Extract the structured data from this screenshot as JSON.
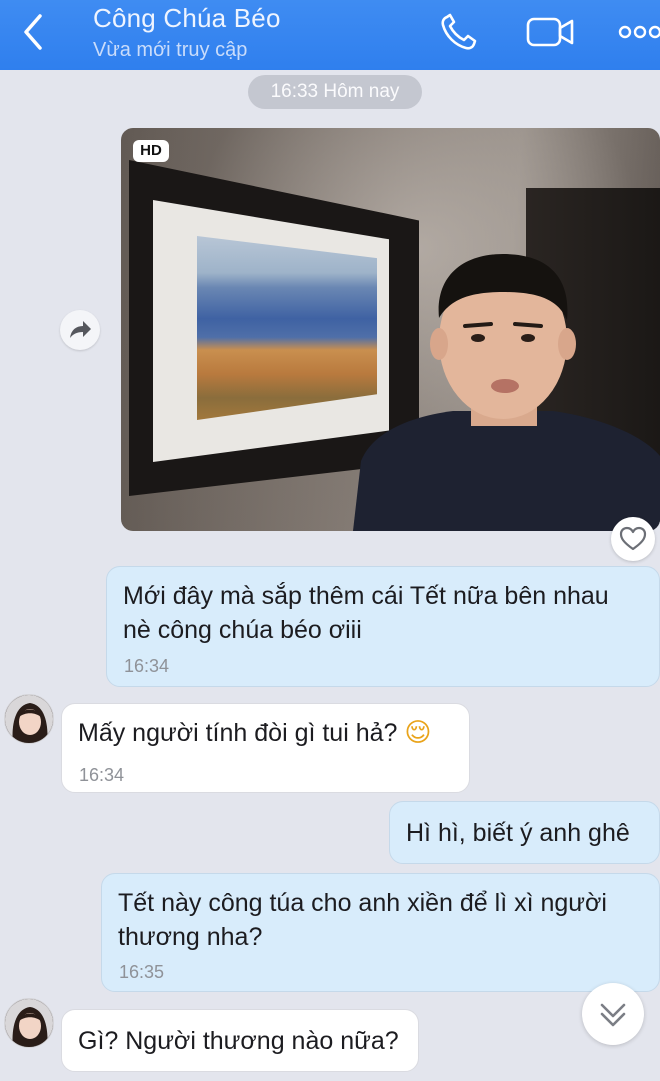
{
  "header": {
    "title": "Công Chúa Béo",
    "status": "Vừa mới truy cập",
    "icons": [
      "back-icon",
      "call-icon",
      "video-call-icon",
      "more-icon"
    ],
    "accent_color": "#3386f0"
  },
  "date_separator": "16:33 Hôm nay",
  "photo_message": {
    "badge": "HD",
    "actions": [
      "share-icon",
      "heart-icon"
    ]
  },
  "messages": [
    {
      "direction": "out",
      "text_line1": "Mới đây mà sắp thêm cái Tết nữa bên nhau",
      "text_line2": "nè công chúa béo ơiii",
      "time": "16:34"
    },
    {
      "direction": "in",
      "text": "Mấy người tính đòi gì tui hả?",
      "emoji": "😌",
      "time": "16:34"
    },
    {
      "direction": "out",
      "text": "Hì hì, biết ý anh ghê"
    },
    {
      "direction": "out",
      "text_line1": "Tết này công túa cho anh xiền để lì xì người",
      "text_line2": "thương nha?",
      "time": "16:35"
    },
    {
      "direction": "in",
      "text": "Gì? Người thương nào nữa?"
    }
  ],
  "scroll_button": "chevron-double-down-icon"
}
